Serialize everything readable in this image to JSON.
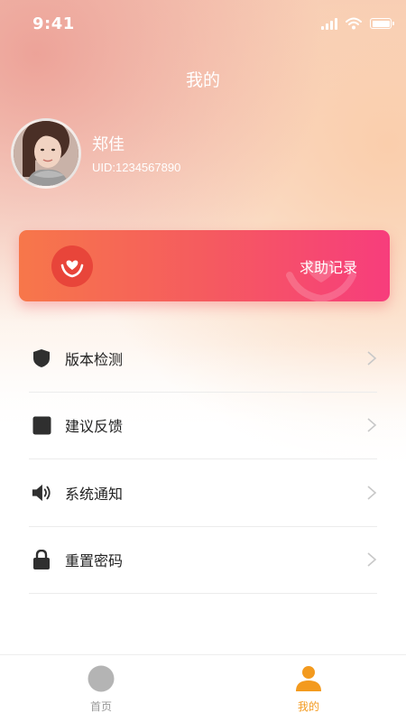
{
  "status_bar": {
    "time": "9:41"
  },
  "header": {
    "title": "我的"
  },
  "profile": {
    "name": "郑佳",
    "uid": "UID:1234567890"
  },
  "help_card": {
    "label": "求助记录",
    "icon": "heart-hands-icon"
  },
  "menu": {
    "items": [
      {
        "label": "版本检测",
        "icon": "shield-icon"
      },
      {
        "label": "建议反馈",
        "icon": "square-icon"
      },
      {
        "label": "系统通知",
        "icon": "speaker-icon"
      },
      {
        "label": "重置密码",
        "icon": "lock-icon"
      }
    ]
  },
  "tab_bar": {
    "tabs": [
      {
        "label": "首页",
        "icon": "home-circle-icon",
        "active": false
      },
      {
        "label": "我的",
        "icon": "person-icon",
        "active": true
      }
    ]
  },
  "colors": {
    "accent_orange": "#f7774a",
    "accent_pink": "#f73d7c",
    "tab_active": "#f39a1e",
    "tab_inactive": "#999999"
  }
}
